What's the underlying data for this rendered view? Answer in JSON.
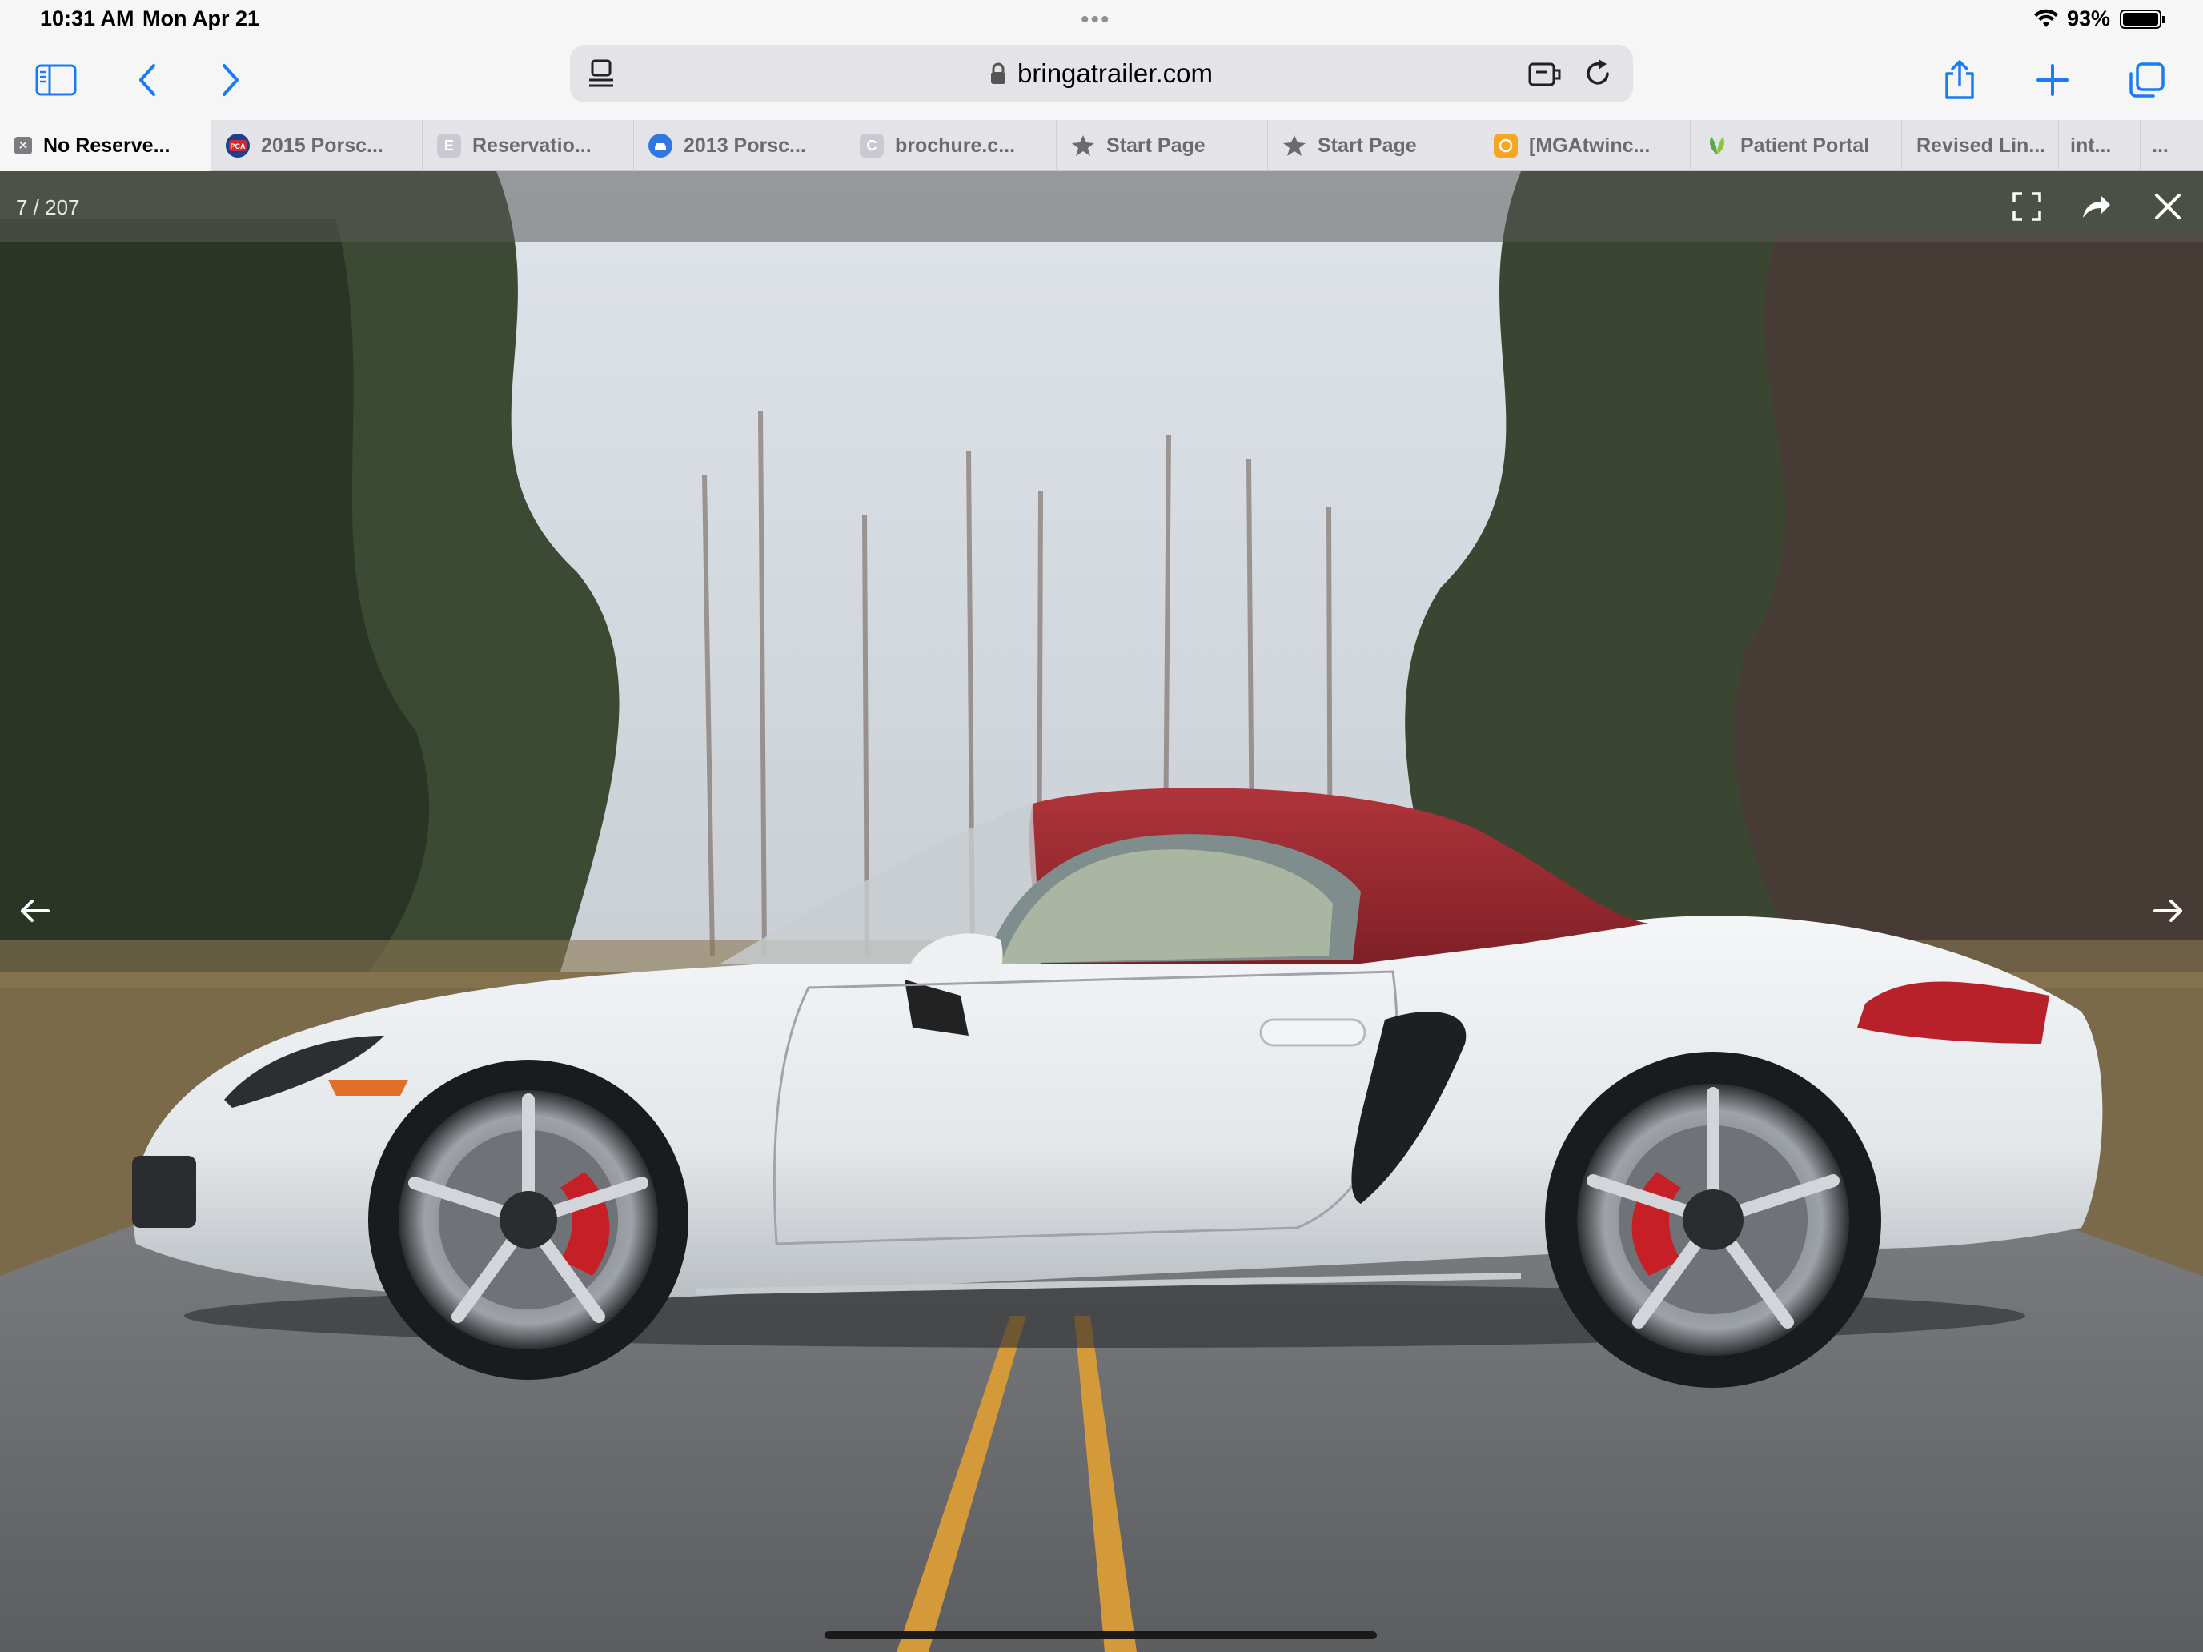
{
  "status_bar": {
    "time": "10:31 AM",
    "date": "Mon Apr 21",
    "battery": "93%",
    "battery_level": 0.93,
    "multitask_dots": "•••"
  },
  "toolbar": {
    "icons": [
      "sidebar-icon",
      "back-chevron-icon",
      "forward-chevron-icon",
      "share-icon",
      "plus-icon",
      "tabs-overview-icon"
    ],
    "accent_color": "#1a7cf5"
  },
  "address_bar": {
    "domain": "bringatrailer.com"
  },
  "tabs": [
    {
      "title": "No Reserve...",
      "favicon": "close-icon",
      "active": true
    },
    {
      "title": "2015 Porsc...",
      "favicon": "pca-icon",
      "fav_color": "#1c3f8f"
    },
    {
      "title": "Reservatio...",
      "favicon": "E",
      "fav_color": "#c9c9d1"
    },
    {
      "title": "2013 Porsc...",
      "favicon": "car-icon",
      "fav_color": "#2f78e3"
    },
    {
      "title": "brochure.c...",
      "favicon": "C",
      "fav_color": "#c9c9d1"
    },
    {
      "title": "Start Page",
      "favicon": "star-icon"
    },
    {
      "title": "Start Page",
      "favicon": "star-icon"
    },
    {
      "title": "[MGAtwinc...",
      "favicon": "orange-ring-icon",
      "fav_color": "#f5a623"
    },
    {
      "title": "Patient Portal",
      "favicon": "leaf-icon",
      "fav_color": "#5aa845"
    },
    {
      "title": "Revised Lin...",
      "favicon": "none"
    },
    {
      "title": "int...",
      "favicon": "none"
    },
    {
      "title": "...",
      "favicon": "none"
    }
  ],
  "viewer": {
    "counter": "7 / 207",
    "icons": [
      "fullscreen-icon",
      "share-arrow-icon",
      "close-icon",
      "prev-arrow-icon",
      "next-arrow-icon"
    ],
    "photo_subject": "white convertible with red soft top on a two-lane road",
    "car_color": "#e8ebee",
    "top_color": "#9e2a30"
  }
}
